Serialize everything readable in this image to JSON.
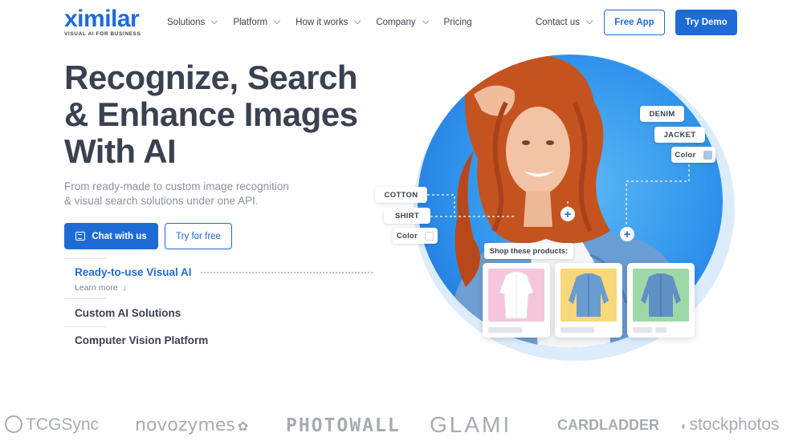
{
  "brand": {
    "name": "ximilar",
    "tagline": "VISUAL AI FOR BUSINESS"
  },
  "nav": {
    "items": [
      {
        "label": "Solutions",
        "dropdown": true
      },
      {
        "label": "Platform",
        "dropdown": true
      },
      {
        "label": "How it works",
        "dropdown": true
      },
      {
        "label": "Company",
        "dropdown": true
      },
      {
        "label": "Pricing",
        "dropdown": false
      }
    ],
    "contact": "Contact us",
    "free_app": "Free App",
    "try_demo": "Try Demo"
  },
  "hero": {
    "headline": [
      "Recognize, Search",
      "& Enhance Images",
      "With AI"
    ],
    "subtitle": [
      "From ready-made to custom image recognition",
      "& visual search solutions under one API."
    ],
    "chat_button": "Chat with us",
    "try_button": "Try for free"
  },
  "solutions": {
    "active": "Ready-to-use Visual AI",
    "learn_more": "Learn more",
    "items": [
      "Custom AI Solutions",
      "Computer Vision Platform"
    ]
  },
  "illustration": {
    "tags": [
      "DENIM",
      "JACKET",
      "Color",
      "COTTON",
      "SHIRT",
      "Color"
    ],
    "shop_label": "Shop these products:"
  },
  "client_logos": [
    "TCGSync",
    "novozymes",
    "PHOTOWALL",
    "GLAMI",
    "CARDLADDER",
    "stockphotos"
  ],
  "colors": {
    "accent": "#1f6bd6",
    "text": "#3a4150",
    "jacket_swatch": "#a9c4e4",
    "shirt_swatch": "#ffffff"
  }
}
